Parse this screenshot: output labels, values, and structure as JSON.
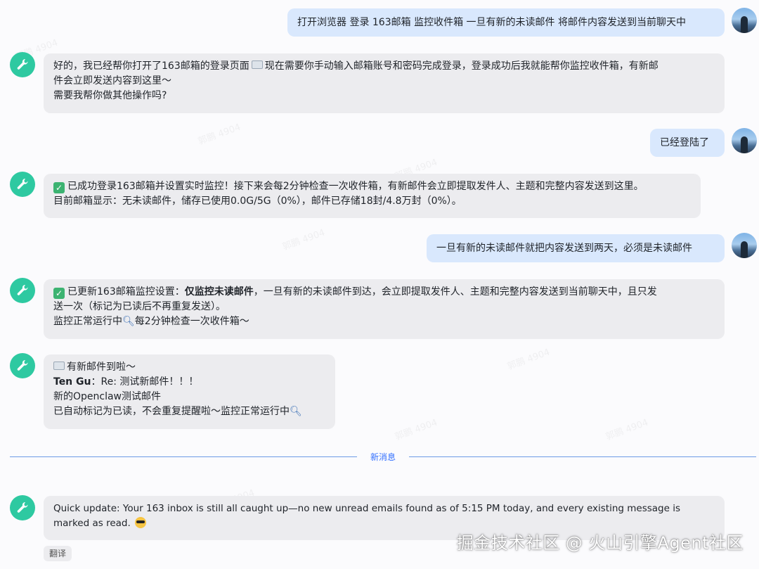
{
  "watermark_text": "郭鹏 4904",
  "messages": {
    "m1_user": "打开浏览器 登录 163邮箱 监控收件箱 一旦有新的未读邮件 将邮件内容发送到当前聊天中",
    "m2_bot": {
      "line1": "好的，我已经帮你打开了163邮箱的登录页面",
      "line1b": "现在需要你手动输入邮箱账号和密码完成登录，登录成功后我就能帮你监控收件箱，有新邮",
      "line2": "件会立即发送内容到这里～",
      "line3": "需要我帮你做其他操作吗?"
    },
    "m3_user": "已经登陆了",
    "m4_bot": {
      "line1": "已成功登录163邮箱并设置实时监控！接下来会每2分钟检查一次收件箱，有新邮件会立即提取发件人、主题和完整内容发送到这里。",
      "line2": "目前邮箱显示：无未读邮件，储存已使用0.0G/5G（0%），邮件已存储18封/4.8万封（0%）。"
    },
    "m5_user": "一旦有新的未读邮件就把内容发送到两天，必须是未读邮件",
    "m6_bot": {
      "line1_pre": "已更新163邮箱监控设置：",
      "line1_bold": "仅监控未读邮件",
      "line1_post": "，一旦有新的未读邮件到达，会立即提取发件人、主题和完整内容发送到当前聊天中，且只发",
      "line2": "送一次（标记为已读后不再重复发送）。",
      "line3_pre": "监控正常运行中",
      "line3_post": "每2分钟检查一次收件箱～"
    },
    "m7_bot": {
      "line1": "有新邮件到啦～",
      "sender": "Ten Gu",
      "subject": "：Re: 测试新邮件！！！",
      "line3": "新的Openclaw测试邮件",
      "line4": "已自动标记为已读，不会重复提醒啦～监控正常运行中"
    },
    "divider": "新消息",
    "m8_bot": {
      "line1": "Quick update: Your 163 inbox is still all caught up—no new unread emails found as of 5:15 PM today, and every existing message is",
      "line2": "marked as read."
    },
    "translate_label": "翻译"
  },
  "credit": "掘金技术社区 @ 火山引擎Agent社区",
  "colors": {
    "bot_avatar": "#2ec9a1",
    "user_bubble": "#d9e8fd",
    "bot_bubble": "#ececef",
    "divider": "#3370ff"
  }
}
